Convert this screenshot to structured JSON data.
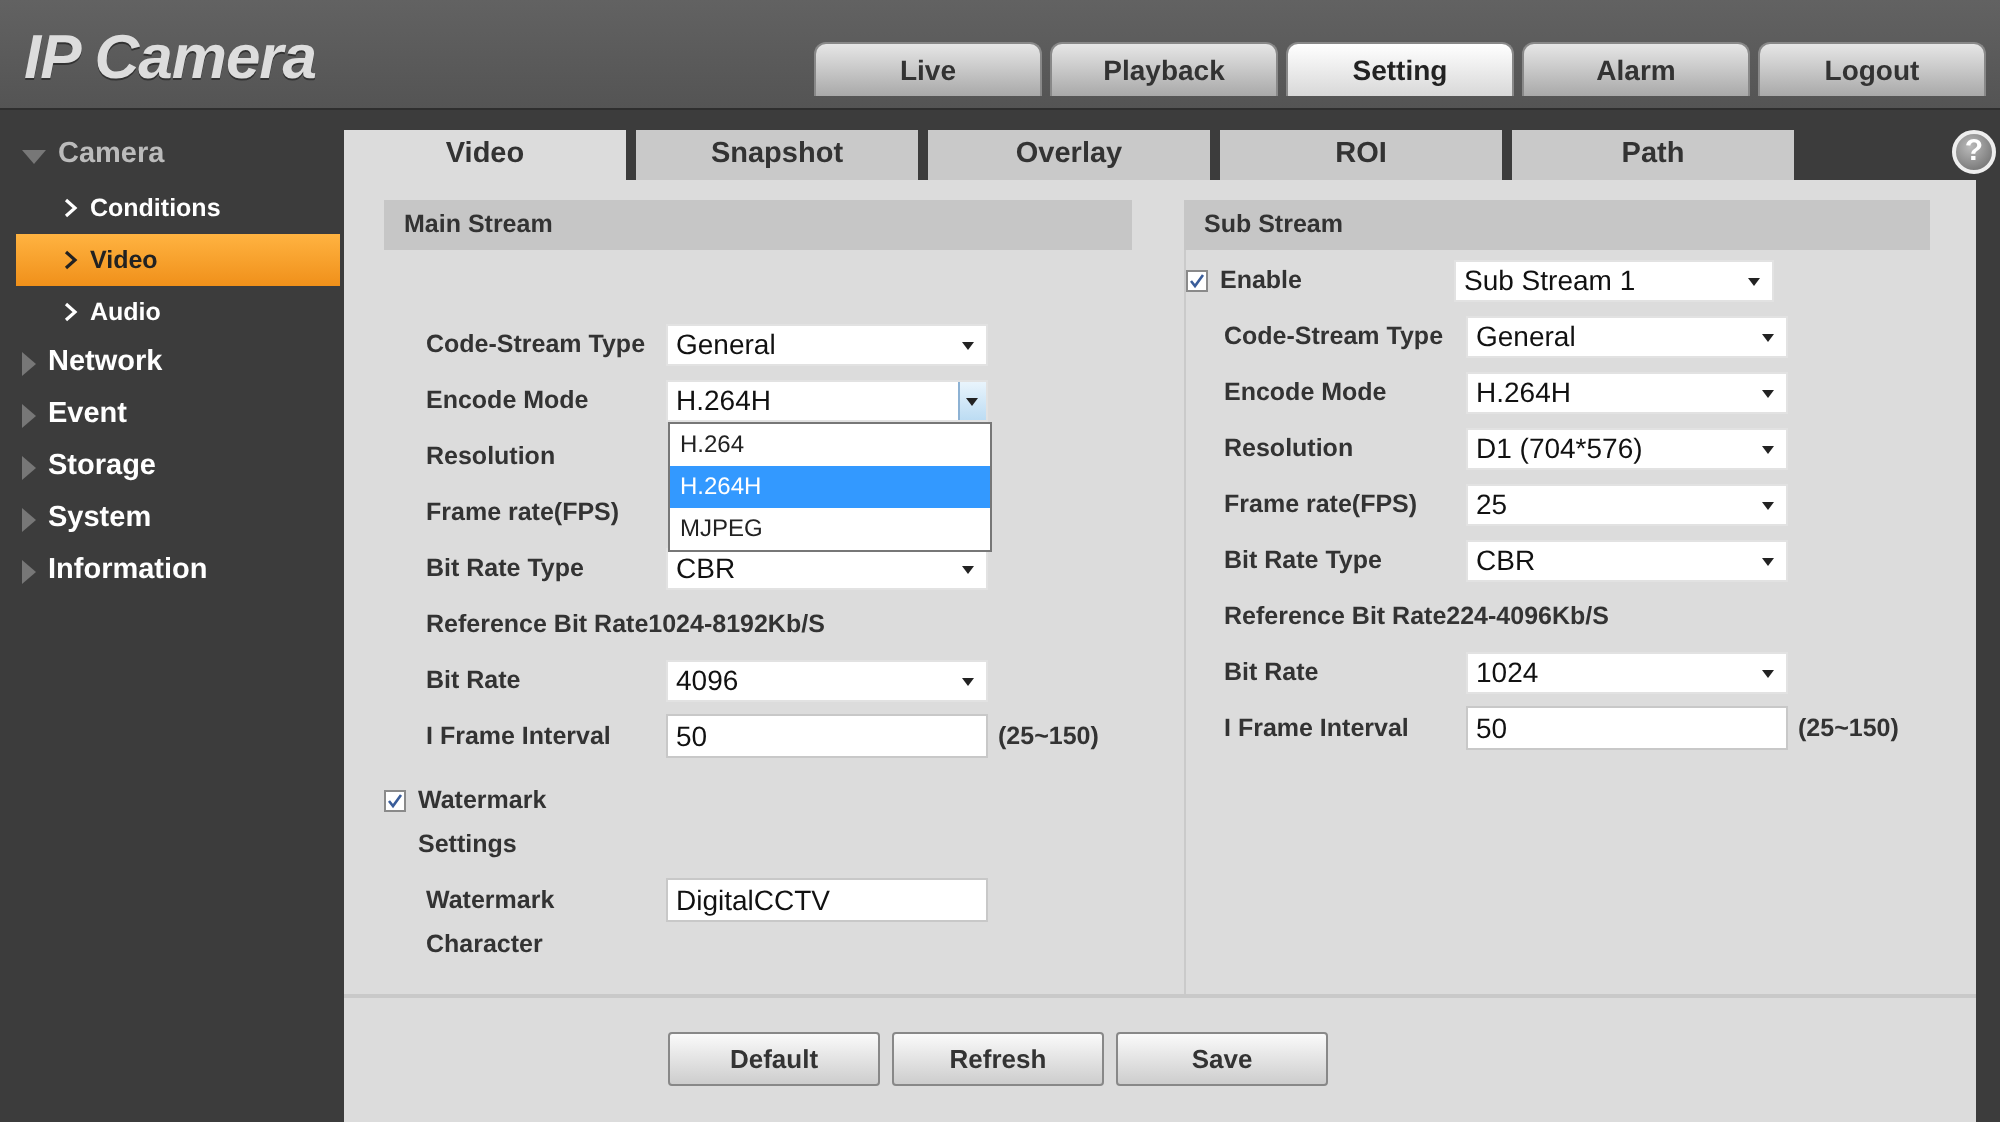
{
  "app": {
    "logo": "IP Camera"
  },
  "top_tabs": [
    {
      "label": "Live",
      "selected": false
    },
    {
      "label": "Playback",
      "selected": false
    },
    {
      "label": "Setting",
      "selected": true
    },
    {
      "label": "Alarm",
      "selected": false
    },
    {
      "label": "Logout",
      "selected": false
    }
  ],
  "sidebar": {
    "items": [
      {
        "label": "Camera",
        "expanded": true,
        "children": [
          {
            "label": "Conditions",
            "selected": false
          },
          {
            "label": "Video",
            "selected": true
          },
          {
            "label": "Audio",
            "selected": false
          }
        ]
      },
      {
        "label": "Network",
        "expanded": false
      },
      {
        "label": "Event",
        "expanded": false
      },
      {
        "label": "Storage",
        "expanded": false
      },
      {
        "label": "System",
        "expanded": false
      },
      {
        "label": "Information",
        "expanded": false
      }
    ]
  },
  "sub_tabs": [
    {
      "label": "Video",
      "selected": true
    },
    {
      "label": "Snapshot",
      "selected": false
    },
    {
      "label": "Overlay",
      "selected": false
    },
    {
      "label": "ROI",
      "selected": false
    },
    {
      "label": "Path",
      "selected": false
    }
  ],
  "help_icon": "?",
  "main_stream": {
    "title": "Main Stream",
    "rows": [
      {
        "kind": "select",
        "label": "Code-Stream Type",
        "value": "General"
      },
      {
        "kind": "select",
        "label": "Encode Mode",
        "value": "H.264H",
        "open": true,
        "options": [
          {
            "label": "H.264",
            "selected": false
          },
          {
            "label": "H.264H",
            "selected": true
          },
          {
            "label": "MJPEG",
            "selected": false
          }
        ]
      },
      {
        "kind": "covered",
        "label": "Resolution"
      },
      {
        "kind": "covered",
        "label": "Frame rate(FPS)"
      },
      {
        "kind": "select",
        "label": "Bit Rate Type",
        "value": "CBR"
      },
      {
        "kind": "text",
        "label": "Reference Bit Rate",
        "value": "1024-8192Kb/S"
      },
      {
        "kind": "select",
        "label": "Bit Rate",
        "value": "4096"
      },
      {
        "kind": "input",
        "label": "I Frame Interval",
        "value": "50",
        "suffix": "(25~150)"
      }
    ]
  },
  "watermark": {
    "label": "Watermark Settings",
    "checked": true,
    "field_label": "Watermark Character",
    "value": "DigitalCCTV"
  },
  "sub_stream": {
    "title": "Sub Stream",
    "enable": {
      "label": "Enable",
      "checked": true,
      "value": "Sub Stream 1"
    },
    "rows": [
      {
        "kind": "select",
        "label": "Code-Stream Type",
        "value": "General"
      },
      {
        "kind": "select",
        "label": "Encode Mode",
        "value": "H.264H"
      },
      {
        "kind": "select",
        "label": "Resolution",
        "value": "D1 (704*576)"
      },
      {
        "kind": "select",
        "label": "Frame rate(FPS)",
        "value": "25"
      },
      {
        "kind": "select",
        "label": "Bit Rate Type",
        "value": "CBR"
      },
      {
        "kind": "text",
        "label": "Reference Bit Rate",
        "value": "224-4096Kb/S"
      },
      {
        "kind": "select",
        "label": "Bit Rate",
        "value": "1024"
      },
      {
        "kind": "input",
        "label": "I Frame Interval",
        "value": "50",
        "suffix": "(25~150)"
      }
    ]
  },
  "buttons": [
    "Default",
    "Refresh",
    "Save"
  ]
}
